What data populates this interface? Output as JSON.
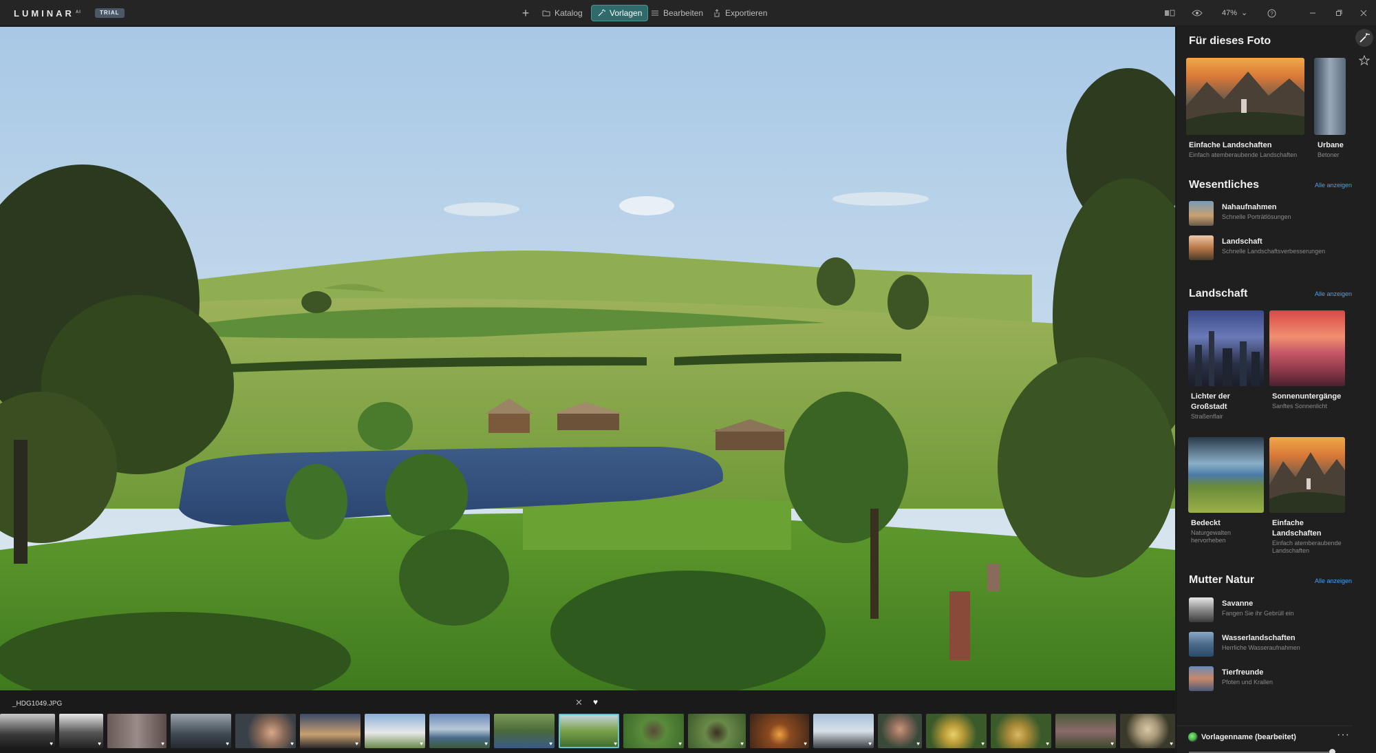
{
  "app": {
    "logo": "LUMINAR",
    "logo_sup": "AI",
    "trial_badge": "TRIAL"
  },
  "nav": {
    "add": "+",
    "katalog": "Katalog",
    "vorlagen": "Vorlagen",
    "bearbeiten": "Bearbeiten",
    "exportieren": "Exportieren"
  },
  "toolbar": {
    "zoom": "47%",
    "zoom_caret": "⌄",
    "icons": [
      "compare-icon",
      "eye-icon",
      "help-icon",
      "minimize-icon",
      "restore-icon",
      "close-icon"
    ]
  },
  "panel": {
    "for_photo": {
      "title": "Für dieses Foto",
      "cards": [
        {
          "title": "Einfache Landschaften",
          "subtitle": "Einfach atemberaubende Landschaften"
        },
        {
          "title": "Urbane",
          "subtitle": "Betoner"
        }
      ]
    },
    "essentials": {
      "title": "Wesentliches",
      "show_all": "Alle anzeigen",
      "rows": [
        {
          "title": "Nahaufnahmen",
          "subtitle": "Schnelle Porträtlösungen"
        },
        {
          "title": "Landschaft",
          "subtitle": "Schnelle Landschaftsverbesserungen"
        }
      ]
    },
    "landscape": {
      "title": "Landschaft",
      "show_all": "Alle anzeigen",
      "cards": [
        {
          "title_line1": "Lichter der",
          "title_line2": "Großstadt",
          "subtitle": "Straßenflair"
        },
        {
          "title_line1": "Sonnenuntergänge",
          "title_line2": "",
          "subtitle": "Sanftes Sonnenlicht"
        },
        {
          "title_line1": "Bedeckt",
          "title_line2": "",
          "subtitle": "Naturgewalten hervorheben"
        },
        {
          "title_line1": "Einfache",
          "title_line2": "Landschaften",
          "subtitle": "Einfach atemberaubende Landschaften"
        }
      ]
    },
    "mother_nature": {
      "title": "Mutter Natur",
      "show_all": "Alle anzeigen",
      "rows": [
        {
          "title": "Savanne",
          "subtitle": "Fangen Sie ihr Gebrüll ein"
        },
        {
          "title": "Wasserlandschaften",
          "subtitle": "Herrliche Wasseraufnahmen"
        },
        {
          "title": "Tierfreunde",
          "subtitle": "Pfoten und Krallen"
        }
      ]
    },
    "bottom": {
      "template_name": "Vorlagenname (bearbeitet)",
      "more": "···",
      "amount": 1.0
    }
  },
  "filmstrip": {
    "filename": "_HDG1049.JPG",
    "close": "✕",
    "heart": "♥",
    "selected_index": 8
  },
  "colors": {
    "accent": "#2f6b6b",
    "accent_border": "#4c9696",
    "link": "#4aa0f0",
    "selection": "#5fc5cf"
  }
}
